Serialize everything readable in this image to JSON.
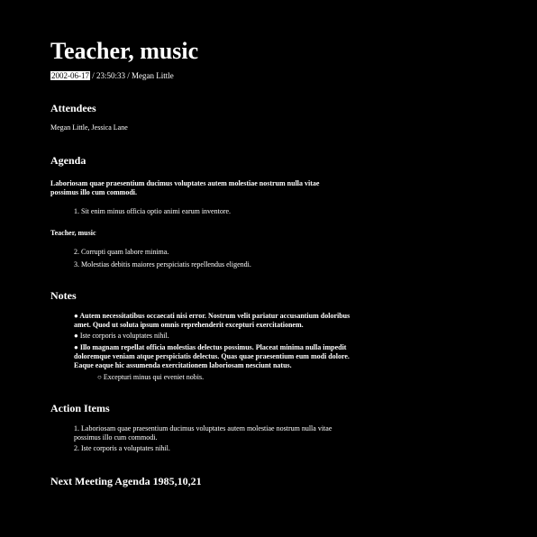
{
  "title": "Teacher, music",
  "meta": {
    "date": "2002-06-17",
    "rest": " / 23:50:33 / Megan Little"
  },
  "attendees": {
    "heading": "Attendees",
    "names": "Megan Little, Jessica Lane"
  },
  "agenda": {
    "heading": "Agenda",
    "intro": "Laboriosam quae praesentium ducimus voluptates autem molestiae nostrum nulla vitae possimus illo cum commodi.",
    "items_a": [
      "1. Sit enim minus officia optio animi earum inventore."
    ],
    "subheading": "Teacher, music",
    "items_b": [
      "2. Corrupti quam labore minima.",
      "3. Molestias debitis maiores perspiciatis repellendus eligendi."
    ]
  },
  "notes": {
    "heading": "Notes",
    "items": [
      "● Autem necessitatibus occaecati nisi error. Nostrum velit pariatur accusantium doloribus amet. Quod ut soluta ipsum omnis reprehenderit excepturi exercitationem.",
      "● Iste corporis a voluptates nihil.",
      "● Illo magnam repellat officia molestias delectus possimus. Placeat minima nulla impedit doloremque veniam atque perspiciatis delectus. Quas quae praesentium eum modi dolore. Eaque eaque hic assumenda exercitationem laboriosam nesciunt natus."
    ],
    "subitem": "○ Excepturi minus qui eveniet nobis."
  },
  "action_items": {
    "heading": "Action Items",
    "items": [
      "1. Laboriosam quae praesentium ducimus voluptates autem molestiae nostrum nulla vitae possimus illo cum commodi.",
      "2. Iste corporis a voluptates nihil."
    ]
  },
  "next_meeting": "Next Meeting Agenda 1985,10,21"
}
